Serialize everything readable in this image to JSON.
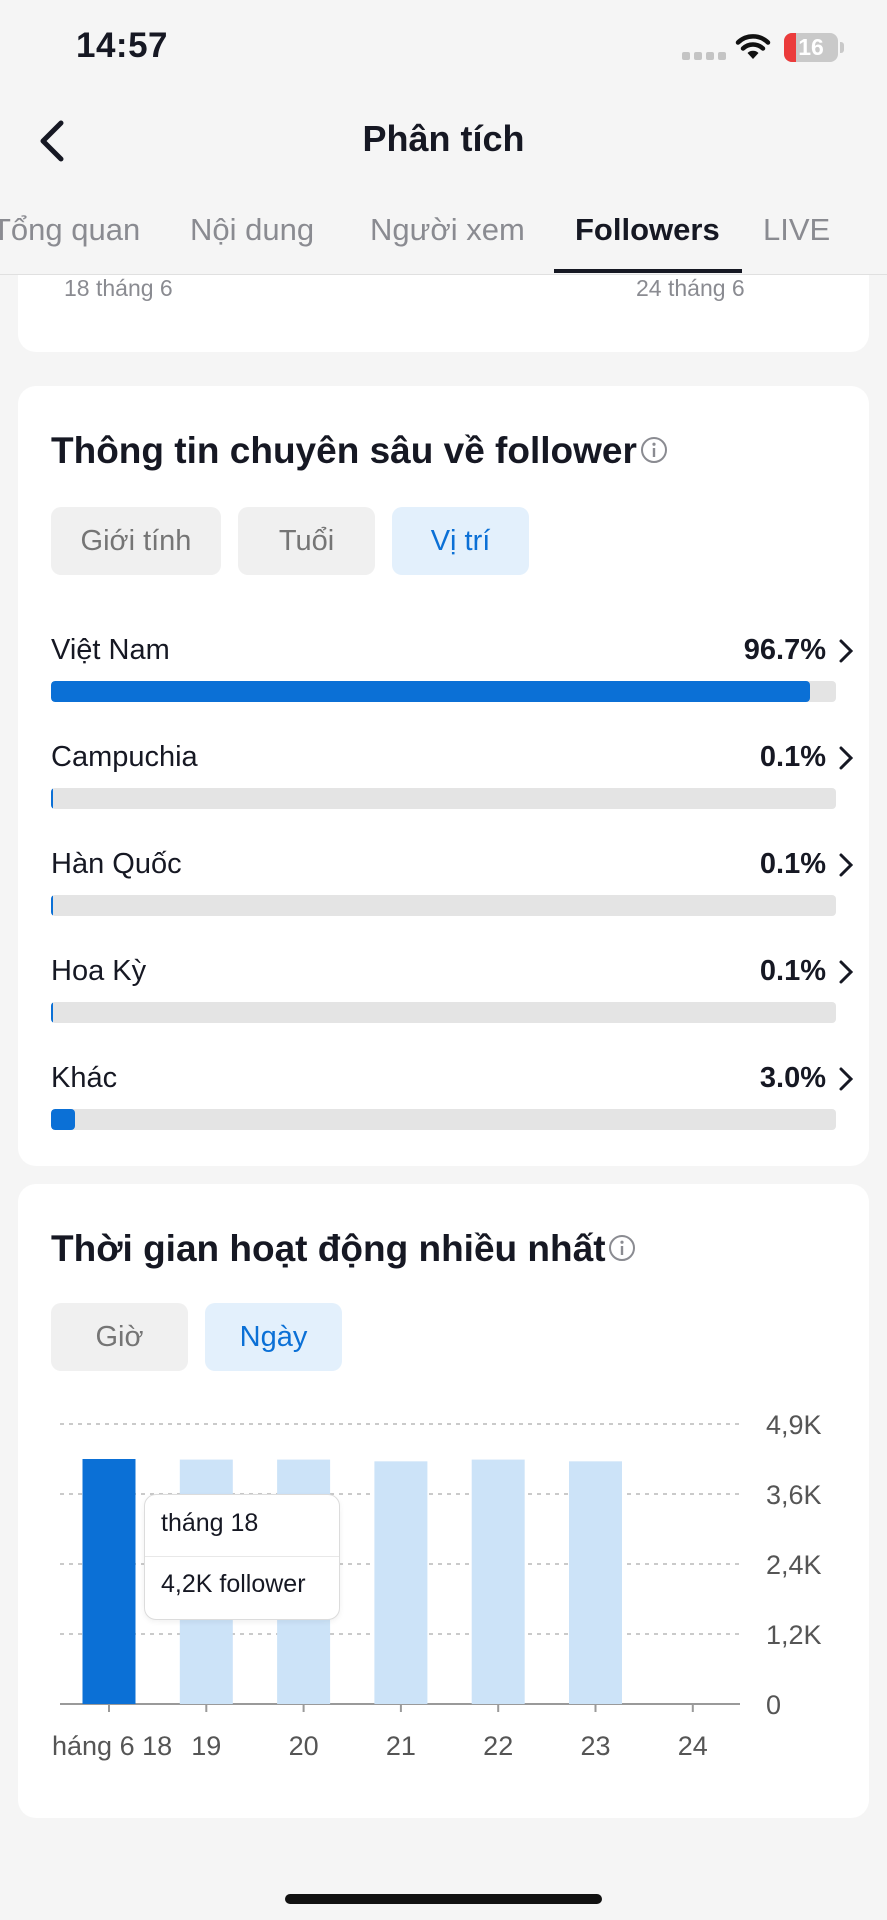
{
  "status_bar": {
    "time": "14:57",
    "battery": "16"
  },
  "header": {
    "title": "Phân tích"
  },
  "tabs": [
    {
      "label": "Tổng quan",
      "active": false
    },
    {
      "label": "Nội dung",
      "active": false
    },
    {
      "label": "Người xem",
      "active": false
    },
    {
      "label": "Followers",
      "active": true
    },
    {
      "label": "LIVE",
      "active": false
    }
  ],
  "top_card": {
    "start_date": "18 tháng 6",
    "end_date": "24 tháng 6"
  },
  "insights": {
    "title": "Thông tin chuyên sâu về follower",
    "segments": [
      {
        "label": "Giới tính",
        "active": false
      },
      {
        "label": "Tuổi",
        "active": false
      },
      {
        "label": "Vị trí",
        "active": true
      }
    ],
    "locations": [
      {
        "name": "Việt Nam",
        "percent_label": "96.7%",
        "value": 96.7
      },
      {
        "name": "Campuchia",
        "percent_label": "0.1%",
        "value": 0.1
      },
      {
        "name": "Hàn Quốc",
        "percent_label": "0.1%",
        "value": 0.1
      },
      {
        "name": "Hoa Kỳ",
        "percent_label": "0.1%",
        "value": 0.1
      },
      {
        "name": "Khác",
        "percent_label": "3.0%",
        "value": 3.0
      }
    ]
  },
  "activity": {
    "title": "Thời gian hoạt động nhiều nhất",
    "segments": [
      {
        "label": "Giờ",
        "active": false
      },
      {
        "label": "Ngày",
        "active": true
      }
    ],
    "tooltip": {
      "line1": "tháng 18",
      "line2": "4,2K follower"
    }
  },
  "chart_data": {
    "type": "bar",
    "categories": [
      "háng 6 18",
      "19",
      "20",
      "21",
      "22",
      "23",
      "24"
    ],
    "values": [
      4200,
      4190,
      4190,
      4160,
      4190,
      4160,
      0
    ],
    "highlighted_index": 0,
    "y_ticks": [
      "0",
      "1,2K",
      "2,4K",
      "3,6K",
      "4,9K"
    ],
    "y_tick_values": [
      0,
      1200,
      2400,
      3600,
      4800
    ],
    "ylim": [
      0,
      4800
    ],
    "grid": true,
    "colors": {
      "highlight": "#0b70d6",
      "bar": "#cce3f8",
      "grid": "#b8b8b8",
      "axis": "#9a9a9a",
      "tick_text": "#555555"
    }
  }
}
